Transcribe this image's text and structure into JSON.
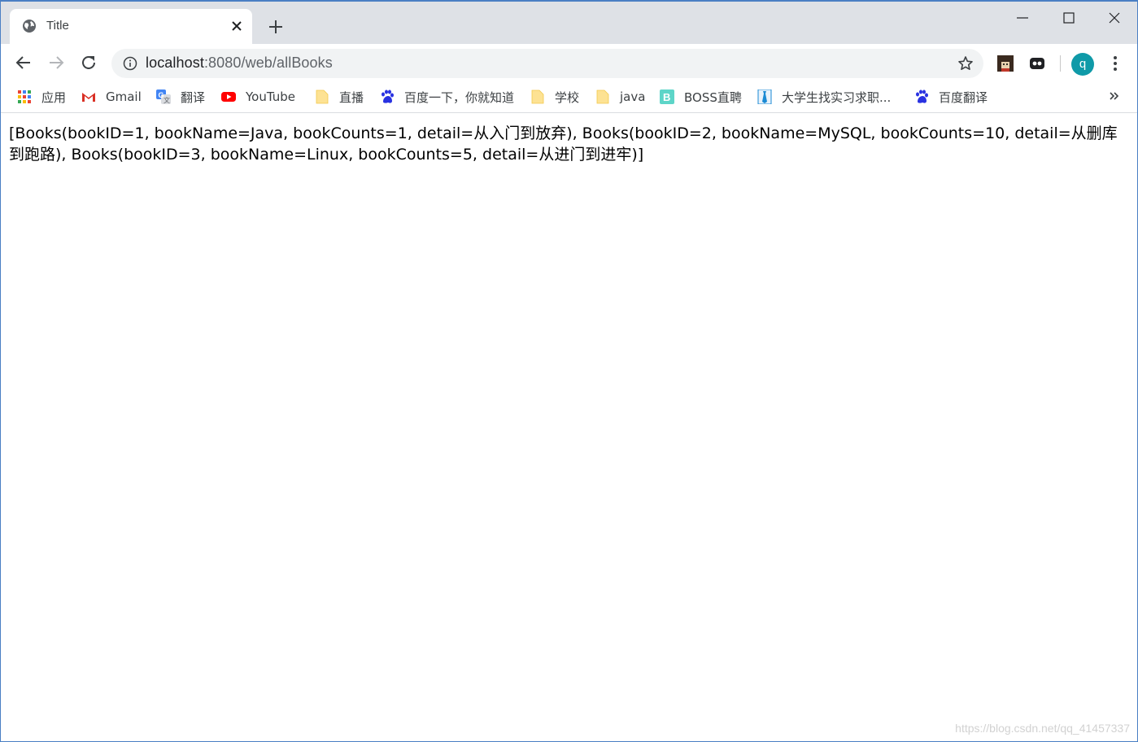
{
  "tab": {
    "title": "Title",
    "favicon": "globe-icon"
  },
  "address_bar": {
    "host": "localhost",
    "path": ":8080/web/allBooks"
  },
  "profile": {
    "initial": "q",
    "color": "#0f9aa8"
  },
  "bookmarks": [
    {
      "label": "应用",
      "icon": "apps-grid-icon"
    },
    {
      "label": "Gmail",
      "icon": "gmail-icon"
    },
    {
      "label": "翻译",
      "icon": "google-translate-icon"
    },
    {
      "label": "YouTube",
      "icon": "youtube-icon"
    },
    {
      "label": "直播",
      "icon": "folder-icon"
    },
    {
      "label": "百度一下，你就知道",
      "icon": "baidu-paw-icon"
    },
    {
      "label": "学校",
      "icon": "folder-icon"
    },
    {
      "label": "java",
      "icon": "folder-icon"
    },
    {
      "label": "BOSS直聘",
      "icon": "boss-icon"
    },
    {
      "label": "大学生找实习求职...",
      "icon": "tie-icon"
    },
    {
      "label": "百度翻译",
      "icon": "baidu-paw-icon"
    }
  ],
  "page": {
    "body_text": "[Books(bookID=1, bookName=Java, bookCounts=1, detail=从入门到放弃), Books(bookID=2, bookName=MySQL, bookCounts=10, detail=从删库到跑路), Books(bookID=3, bookName=Linux, bookCounts=5, detail=从进门到进牢)]"
  },
  "watermark": "https://blog.csdn.net/qq_41457337"
}
